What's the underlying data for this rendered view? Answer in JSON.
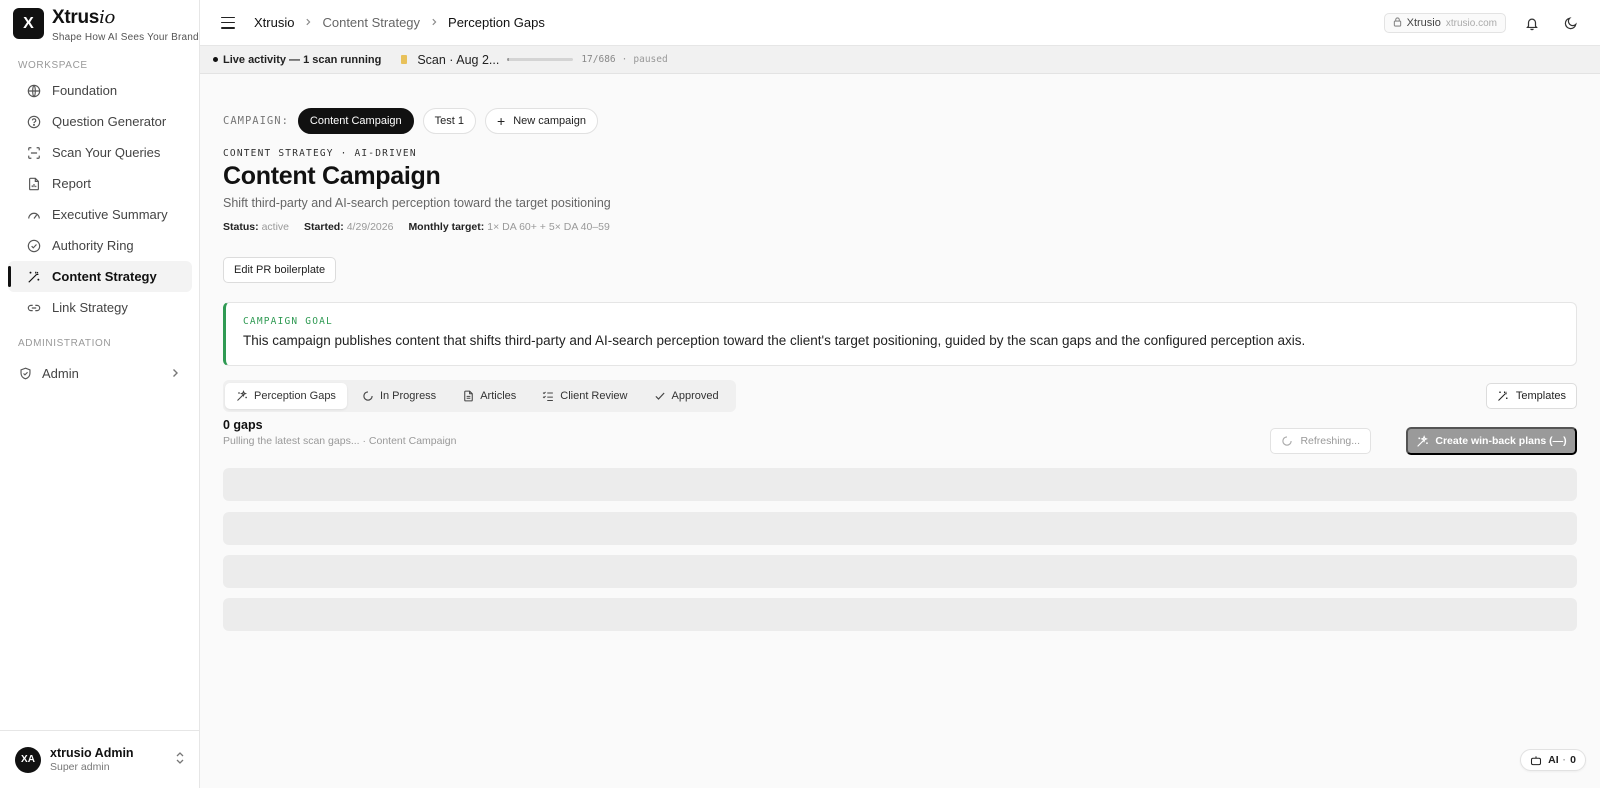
{
  "brand": {
    "logo_letter": "X",
    "name_main": "Xtrus",
    "name_italic": "io",
    "tagline": "Shape How AI Sees Your Brand"
  },
  "sidebar": {
    "workspace_label": "WORKSPACE",
    "items": [
      {
        "label": "Foundation",
        "icon": "globe-icon"
      },
      {
        "label": "Question Generator",
        "icon": "help-circle-icon"
      },
      {
        "label": "Scan Your Queries",
        "icon": "scan-icon"
      },
      {
        "label": "Report",
        "icon": "file-chart-icon"
      },
      {
        "label": "Executive Summary",
        "icon": "gauge-icon"
      },
      {
        "label": "Authority Ring",
        "icon": "check-circle-icon"
      },
      {
        "label": "Content Strategy",
        "icon": "wand-icon",
        "active": true
      },
      {
        "label": "Link Strategy",
        "icon": "link-icon"
      }
    ],
    "admin_label": "ADMINISTRATION",
    "admin_item": "Admin"
  },
  "user": {
    "initials": "XA",
    "name": "xtrusio Admin",
    "role": "Super admin"
  },
  "topbar": {
    "breadcrumbs": [
      "Xtrusio",
      "Content Strategy",
      "Perception Gaps"
    ],
    "domain_name": "Xtrusio",
    "domain_url": "xtrusio.com"
  },
  "activity": {
    "live_text": "Live activity — 1 scan running",
    "scan_label": "Scan · Aug 2...",
    "scan_count": "17/686",
    "scan_separator": "·",
    "scan_state": "paused",
    "progress_fraction": 0.025
  },
  "campaign": {
    "label": "CAMPAIGN:",
    "pills": [
      "Content Campaign",
      "Test 1"
    ],
    "new_label": "New campaign",
    "eyebrow": "CONTENT STRATEGY · AI-DRIVEN",
    "title": "Content Campaign",
    "subtitle": "Shift third-party and AI-search perception toward the target positioning",
    "status_key": "Status:",
    "status_value": "active",
    "started_key": "Started:",
    "started_value": "4/29/2026",
    "target_key": "Monthly target:",
    "target_value": "1× DA 60+ + 5× DA 40–59",
    "edit_button": "Edit PR boilerplate"
  },
  "goal": {
    "label": "CAMPAIGN GOAL",
    "text": "This campaign publishes content that shifts third-party and AI-search perception toward the client's target positioning, guided by the scan gaps and the configured perception axis.",
    "accent_color": "#2f9a53"
  },
  "tabs": [
    {
      "label": "Perception Gaps",
      "icon": "sparkles-icon",
      "active": true
    },
    {
      "label": "In Progress",
      "icon": "refresh-icon"
    },
    {
      "label": "Articles",
      "icon": "document-icon"
    },
    {
      "label": "Client Review",
      "icon": "checklist-icon"
    },
    {
      "label": "Approved",
      "icon": "check-icon"
    }
  ],
  "templates_button": "Templates",
  "gaps": {
    "count": "0 gaps",
    "sub": "Pulling the latest scan gaps... · Content Campaign",
    "refresh_label": "Refreshing...",
    "winback_label": "Create win-back plans (—)"
  },
  "ai_chip": {
    "label": "AI",
    "separator": "·",
    "count": "0"
  }
}
